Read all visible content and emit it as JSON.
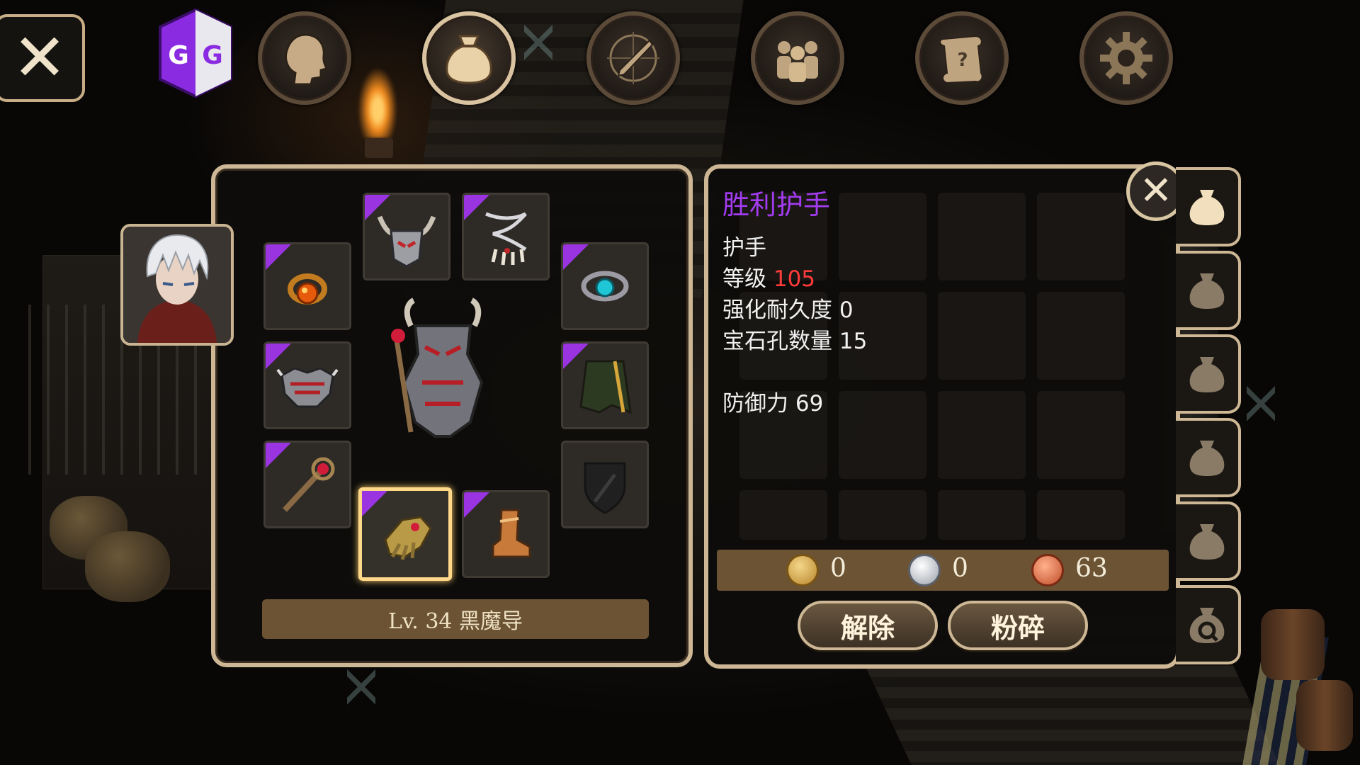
{
  "top_nav": {
    "close_label": "✕",
    "gg_letters": "GG",
    "buttons": [
      {
        "name": "character",
        "icon": "head-icon",
        "active": false
      },
      {
        "name": "inventory",
        "icon": "bag-icon",
        "active": true
      },
      {
        "name": "skills",
        "icon": "sword-compass-icon",
        "active": false
      },
      {
        "name": "party",
        "icon": "people-icon",
        "active": false
      },
      {
        "name": "quests",
        "icon": "scroll-icon",
        "active": false
      },
      {
        "name": "settings",
        "icon": "gear-icon",
        "active": false
      }
    ]
  },
  "equipment": {
    "slots": [
      {
        "name": "helmet",
        "icon": "horned-helmet-icon",
        "rarity": "epic",
        "selected": false
      },
      {
        "name": "necklace",
        "icon": "claw-necklace-icon",
        "rarity": "epic",
        "selected": false
      },
      {
        "name": "ring-left",
        "icon": "amber-ring-icon",
        "rarity": "epic",
        "selected": false
      },
      {
        "name": "ring-right",
        "icon": "cyan-ring-icon",
        "rarity": "epic",
        "selected": false
      },
      {
        "name": "armor",
        "icon": "spiked-armor-icon",
        "rarity": "epic",
        "selected": false
      },
      {
        "name": "cape",
        "icon": "cape-icon",
        "rarity": "epic",
        "selected": false
      },
      {
        "name": "weapon",
        "icon": "staff-icon",
        "rarity": "epic",
        "selected": false
      },
      {
        "name": "gloves",
        "icon": "gauntlet-icon",
        "rarity": "epic",
        "selected": true
      },
      {
        "name": "boots",
        "icon": "boot-icon",
        "rarity": "epic",
        "selected": false
      },
      {
        "name": "offhand",
        "icon": "shield-sword-icon",
        "rarity": "empty",
        "selected": false
      }
    ],
    "level_class": "Lv. 34 黑魔导"
  },
  "item_detail": {
    "title": "胜利护手",
    "type": "护手",
    "level_label": "等级",
    "level_value": "105",
    "durability": "强化耐久度 0",
    "gem_slots": "宝石孔数量 15",
    "defense": "防御力 69",
    "close_label": "✕"
  },
  "currency": {
    "gold": "0",
    "silver": "0",
    "copper": "63"
  },
  "actions": {
    "unequip": "解除",
    "smash": "粉碎"
  },
  "bag_tabs": [
    "bag-1",
    "bag-2",
    "bag-3",
    "bag-4",
    "bag-5",
    "bag-q"
  ],
  "colors": {
    "frame": "#cdb795",
    "epic": "#9a33e0",
    "title_purple": "#a33cf0",
    "level_red": "#ff3b3b",
    "bar_brown": "#6b5333"
  }
}
